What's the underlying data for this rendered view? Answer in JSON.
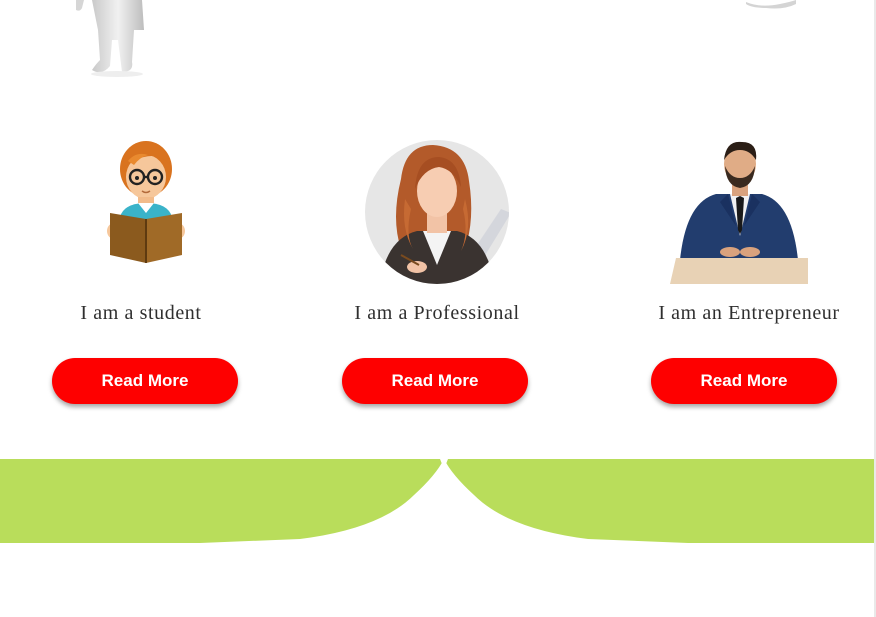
{
  "colors": {
    "accent_button": "#fe0000",
    "band_green": "#b9dd5b",
    "text": "#2f2f2f"
  },
  "cards": [
    {
      "icon": "student-reading-icon",
      "caption": "I am a student",
      "button_label": "Read More"
    },
    {
      "icon": "professional-woman-icon",
      "caption": "I am a Professional",
      "button_label": "Read More"
    },
    {
      "icon": "entrepreneur-man-icon",
      "caption": "I am an Entrepreneur",
      "button_label": "Read More"
    }
  ]
}
